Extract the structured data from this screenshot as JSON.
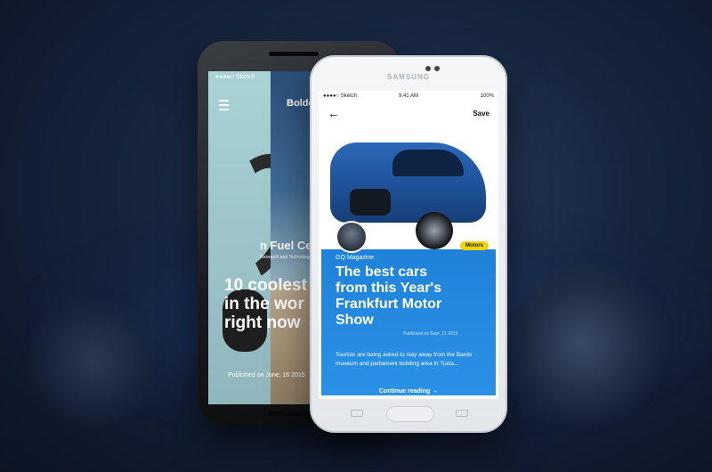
{
  "back_phone": {
    "status": "●●●●○ Sketch",
    "title": "Bolde",
    "fuel_cell": "n Fuel Cell",
    "fuel_sub": "Research and Technology",
    "headline": "10 coolest\nin the wor\nright now",
    "published": "Published on June, 16 2015"
  },
  "front_phone": {
    "brand": "SAMSUNG",
    "status_left": "●●●●○ Sketch",
    "status_time": "9:41 AM",
    "status_battery": "100%",
    "save_label": "Save",
    "tag": "Motors",
    "source": "GQ Magazine",
    "headline": "The best cars\nfrom this Year's\nFrankfurt Motor\nShow",
    "published": "Published on Sept, 21 2015",
    "description": "Tourists are being asked to stay away from the Bardo museum and parliament building area in Tunis...",
    "continue_label": "Continue reading →"
  },
  "colors": {
    "accent_blue": "#1f7fd6",
    "tag_yellow": "#f2d400"
  }
}
